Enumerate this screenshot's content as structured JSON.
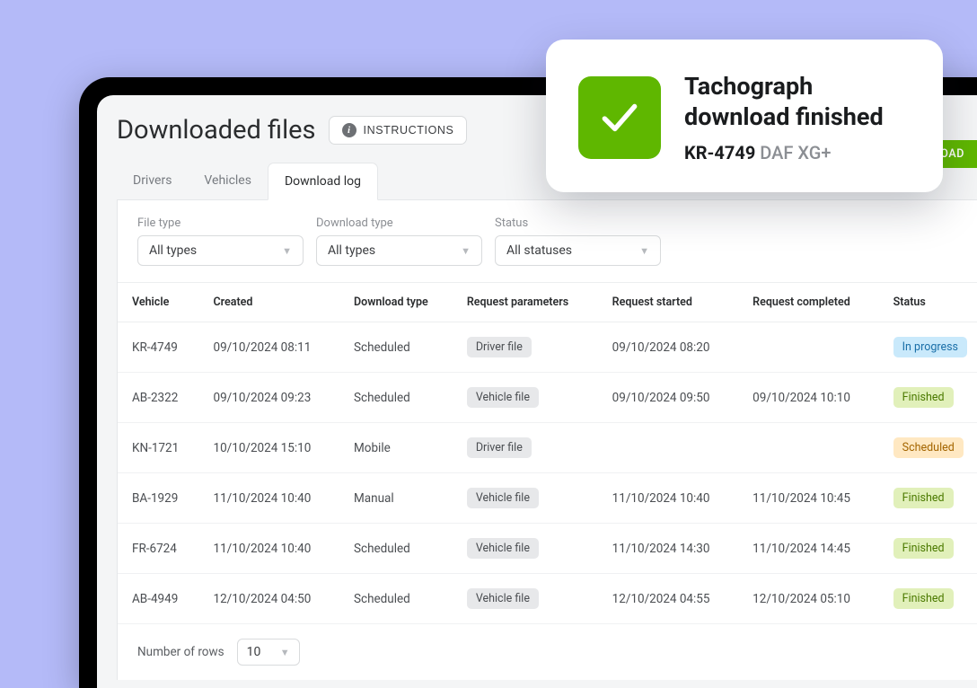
{
  "page": {
    "title": "Downloaded files",
    "instructions_label": "INSTRUCTIONS",
    "download_button": "DOWNLOAD"
  },
  "tabs": {
    "items": [
      "Drivers",
      "Vehicles",
      "Download log"
    ],
    "active_index": 2
  },
  "filters": {
    "file_type": {
      "label": "File type",
      "value": "All types"
    },
    "download_type": {
      "label": "Download type",
      "value": "All types"
    },
    "status": {
      "label": "Status",
      "value": "All statuses"
    }
  },
  "columns": [
    "Vehicle",
    "Created",
    "Download type",
    "Request parameters",
    "Request started",
    "Request completed",
    "Status"
  ],
  "rows": [
    {
      "vehicle": "KR-4749",
      "created": "09/10/2024 08:11",
      "dtype": "Scheduled",
      "param": "Driver file",
      "started": "09/10/2024 08:20",
      "completed": "",
      "status": "In progress",
      "status_class": "inprogress"
    },
    {
      "vehicle": "AB-2322",
      "created": "09/10/2024 09:23",
      "dtype": "Scheduled",
      "param": "Vehicle file",
      "started": "09/10/2024 09:50",
      "completed": "09/10/2024 10:10",
      "status": "Finished",
      "status_class": "finished"
    },
    {
      "vehicle": "KN-1721",
      "created": "10/10/2024 15:10",
      "dtype": "Mobile",
      "param": "Driver file",
      "started": "",
      "completed": "",
      "status": "Scheduled",
      "status_class": "scheduled"
    },
    {
      "vehicle": "BA-1929",
      "created": "11/10/2024 10:40",
      "dtype": "Manual",
      "param": "Vehicle file",
      "started": "11/10/2024 10:40",
      "completed": "11/10/2024 10:45",
      "status": "Finished",
      "status_class": "finished"
    },
    {
      "vehicle": "FR-6724",
      "created": "11/10/2024 10:40",
      "dtype": "Scheduled",
      "param": "Vehicle file",
      "started": "11/10/2024 14:30",
      "completed": "11/10/2024 14:45",
      "status": "Finished",
      "status_class": "finished"
    },
    {
      "vehicle": "AB-4949",
      "created": "12/10/2024 04:50",
      "dtype": "Scheduled",
      "param": "Vehicle file",
      "started": "12/10/2024 04:55",
      "completed": "12/10/2024 05:10",
      "status": "Finished",
      "status_class": "finished"
    }
  ],
  "pager": {
    "label": "Number of rows",
    "value": "10"
  },
  "toast": {
    "title": "Tachograph download finished",
    "vehicle": "KR-4749",
    "model": "DAF XG+"
  }
}
